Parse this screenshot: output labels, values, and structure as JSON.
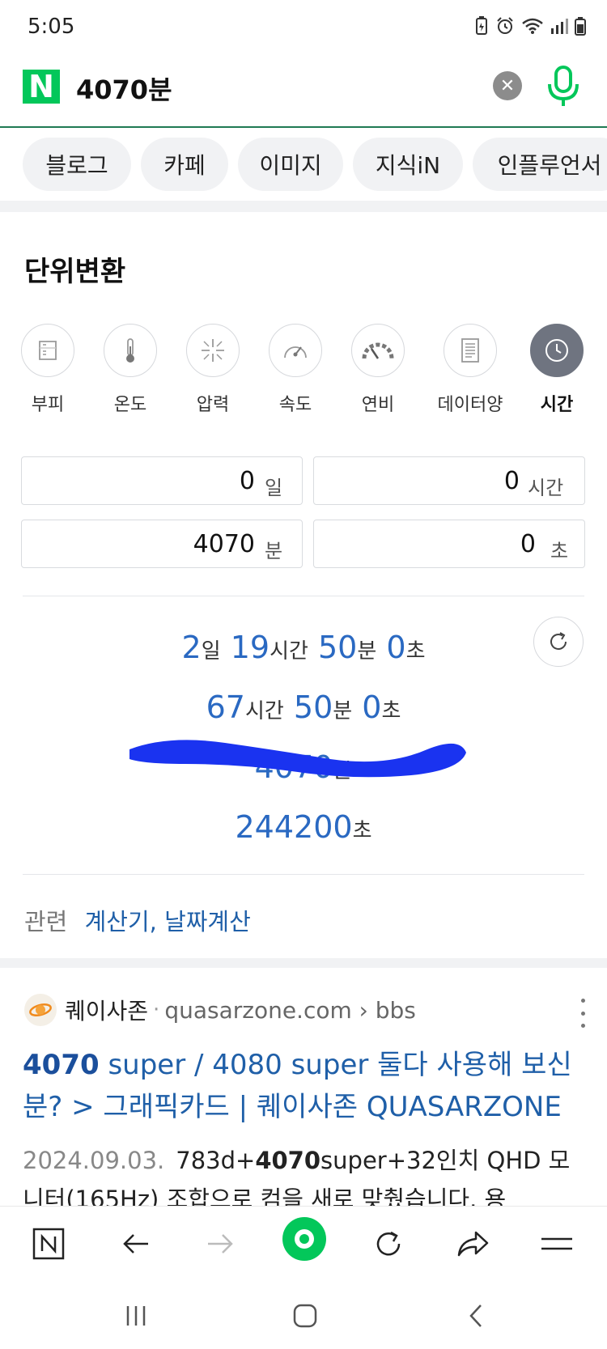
{
  "status": {
    "time": "5:05"
  },
  "search": {
    "logo": "N",
    "query": "4070분"
  },
  "tabs": [
    "블로그",
    "카페",
    "이미지",
    "지식iN",
    "인플루언서"
  ],
  "converter": {
    "title": "단위변환",
    "categories": [
      {
        "label": "부피",
        "icon": "beaker-icon"
      },
      {
        "label": "온도",
        "icon": "thermometer-icon"
      },
      {
        "label": "압력",
        "icon": "pressure-icon"
      },
      {
        "label": "속도",
        "icon": "speedometer-icon"
      },
      {
        "label": "연비",
        "icon": "fuel-gauge-icon"
      },
      {
        "label": "데이터양",
        "icon": "document-icon"
      },
      {
        "label": "시간",
        "icon": "clock-icon",
        "active": true
      }
    ],
    "inputs": {
      "days": {
        "value": "0",
        "unit": "일"
      },
      "hours": {
        "value": "0",
        "unit": "시간"
      },
      "minutes": {
        "value": "4070",
        "unit": "분"
      },
      "seconds": {
        "value": "0",
        "unit": "초"
      }
    },
    "results": {
      "r1": {
        "d": "2",
        "d_u": "일",
        "h": "19",
        "h_u": "시간",
        "m": "50",
        "m_u": "분",
        "s": "0",
        "s_u": "초"
      },
      "r2": {
        "h": "67",
        "h_u": "시간",
        "m": "50",
        "m_u": "분",
        "s": "0",
        "s_u": "초"
      },
      "r3": {
        "m": "4070",
        "m_u": "분"
      },
      "r4": {
        "s": "244200",
        "s_u": "초"
      }
    },
    "related_label": "관련",
    "related_links": "계산기, 날짜계산"
  },
  "result_item": {
    "site_name": "퀘이사존",
    "separator": "·",
    "url": "quasarzone.com › bbs",
    "title_bold": "4070",
    "title_rest": " super / 4080 super 둘다 사용해 보신 분? > 그래픽카드 | 퀘이사존 QUASARZONE",
    "date": "2024.09.03.",
    "snippet_pre": "783d+",
    "snippet_bold": "4070",
    "snippet_post": "super+32인치 QHD 모니터(165Hz) 조합으로 컴을 새로 맞췄습니다. 용"
  },
  "colors": {
    "naver_green": "#03c75a",
    "link_blue": "#1f5fa8",
    "result_blue": "#2a69c2",
    "scribble": "#1a33f0"
  }
}
